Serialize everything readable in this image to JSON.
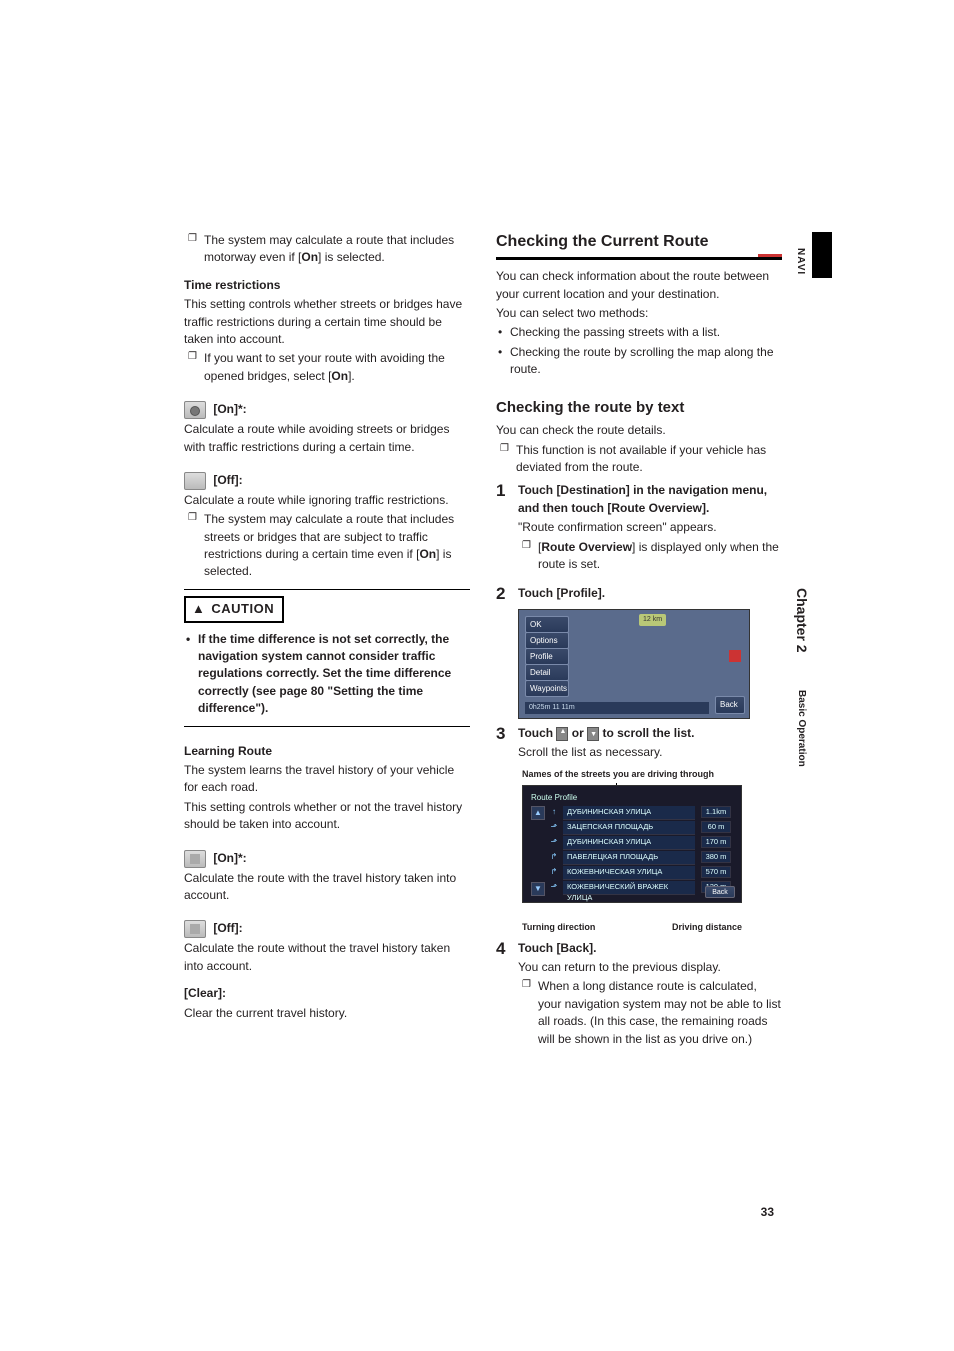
{
  "left": {
    "note1_a": "The system may calculate a route that includes motorway even if [",
    "note1_b": "On",
    "note1_c": "] is selected.",
    "time_restrictions": {
      "title": "Time restrictions",
      "body": "This setting controls whether streets or bridges have traffic restrictions during a certain time should be taken into account.",
      "bullet_a": "If you want to set your route with avoiding the opened bridges, select [",
      "bullet_b": "On",
      "bullet_c": "].",
      "on_label": "[On]*:",
      "on_body": "Calculate a route while avoiding streets or bridges with traffic restrictions during a certain time.",
      "off_label": "[Off]:",
      "off_body": "Calculate a route while ignoring traffic restrictions.",
      "bullet2_a": "The system may calculate a route that includes streets or bridges that are subject to traffic restrictions during a certain time even if [",
      "bullet2_b": "On",
      "bullet2_c": "] is selected."
    },
    "caution": {
      "label": "CAUTION",
      "body_a": "If the time difference is not set correctly, the navigation system cannot consider traffic regulations correctly. Set the time difference correctly (see page 80 ",
      "body_b": "\"Setting the time difference\"",
      "body_c": ")."
    },
    "learning": {
      "title": "Learning Route",
      "body1": "The system learns the travel history of your vehicle for each road.",
      "body2": "This setting controls whether or not the travel history should be taken into account.",
      "on_label": "[On]*:",
      "on_body": "Calculate the route with the travel history taken into account.",
      "off_label": "[Off]:",
      "off_body": "Calculate the route without the travel history taken into account.",
      "clear_label": "[Clear]:",
      "clear_body": "Clear the current travel history."
    }
  },
  "right": {
    "section_title": "Checking the Current Route",
    "intro": "You can check information about the route between your current location and your destination.",
    "intro2": "You can select two methods:",
    "method1": "Checking the passing streets with a list.",
    "method2": "Checking the route by scrolling the map along the route.",
    "sub_title": "Checking the route by text",
    "sub_intro": "You can check the route details.",
    "sub_bullet": "This function is not available if your vehicle has deviated from the route.",
    "step1": {
      "num": "1",
      "title": "Touch [Destination] in the navigation menu, and then touch [Route Overview].",
      "body": "\"Route confirmation screen\" appears.",
      "note_a": "[",
      "note_b": "Route Overview",
      "note_c": "] is displayed only when the route is set."
    },
    "step2": {
      "num": "2",
      "title": "Touch [Profile]."
    },
    "step3": {
      "num": "3",
      "title_a": "Touch ",
      "title_b": " or ",
      "title_c": " to scroll the list.",
      "body": "Scroll the list as necessary.",
      "names_label": "Names of the streets you are driving through",
      "turning": "Turning direction",
      "driving": "Driving distance"
    },
    "step4": {
      "num": "4",
      "title": "Touch [Back].",
      "body": "You can return to the previous display.",
      "note": "When a long distance route is calculated, your navigation system may not be able to list all roads. (In this case, the remaining roads will be shown in the list as you drive on.)"
    }
  },
  "ss1": {
    "ok": "OK",
    "options": "Options",
    "profile": "Profile",
    "detail": "Detail",
    "waypoints": "Waypoints",
    "back": "Back",
    "badge": "12 km",
    "status": "0h25m   11 11m"
  },
  "ss2": {
    "title": "Route Profile",
    "rows": [
      {
        "name": "ДУБИНИНСКАЯ УЛИЦА",
        "dist": "1.1km"
      },
      {
        "name": "ЗАЦЕПСКАЯ ПЛОЩАДЬ",
        "dist": "60 m"
      },
      {
        "name": "ДУБИНИНСКАЯ УЛИЦА",
        "dist": "170 m"
      },
      {
        "name": "ПАВЕЛЕЦКАЯ ПЛОЩАДЬ",
        "dist": "380 m"
      },
      {
        "name": "КОЖЕВНИЧЕСКАЯ УЛИЦА",
        "dist": "570 m"
      },
      {
        "name": "КОЖЕВНИЧЕСКИЙ ВРАЖЕК УЛИЦА",
        "dist": "120 m"
      }
    ],
    "back": "Back"
  },
  "side": {
    "navi": "NAVI",
    "chapter": "Chapter 2",
    "sub": "Basic Operation"
  },
  "page_num": "33"
}
